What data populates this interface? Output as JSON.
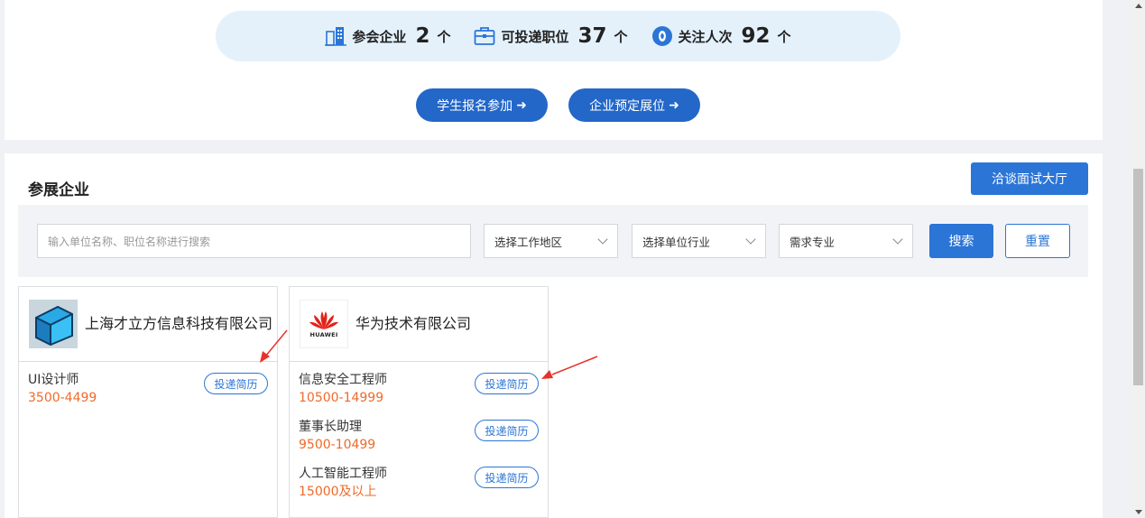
{
  "stats": {
    "companies_label": "参会企业",
    "companies_count": "2",
    "companies_unit": "个",
    "positions_label": "可投递职位",
    "positions_count": "37",
    "positions_unit": "个",
    "views_label": "关注人次",
    "views_count": "92",
    "views_unit": "个"
  },
  "actions": {
    "student_signup": "学生报名参加",
    "company_booth": "企业预定展位",
    "arrow": "➜"
  },
  "section": {
    "title": "参展企业",
    "hall_button": "洽谈面试大厅"
  },
  "filters": {
    "search_placeholder": "输入单位名称、职位名称进行搜索",
    "region": "选择工作地区",
    "industry": "选择单位行业",
    "major": "需求专业",
    "search_button": "搜索",
    "reset_button": "重置"
  },
  "companies": [
    {
      "name": "上海才立方信息科技有限公司",
      "jobs": [
        {
          "title": "UI设计师",
          "salary": "3500-4499",
          "apply": "投递简历"
        }
      ]
    },
    {
      "name": "华为技术有限公司",
      "logo_text": "HUAWEI",
      "jobs": [
        {
          "title": "信息安全工程师",
          "salary": "10500-14999",
          "apply": "投递简历"
        },
        {
          "title": "董事长助理",
          "salary": "9500-10499",
          "apply": "投递简历"
        },
        {
          "title": "人工智能工程师",
          "salary": "15000及以上",
          "apply": "投递简历"
        }
      ]
    }
  ],
  "colors": {
    "primary": "#2b75d6",
    "salary": "#ee6a2a",
    "stats_bg": "#e4f1fb",
    "annotation_arrow": "#e8312a"
  }
}
